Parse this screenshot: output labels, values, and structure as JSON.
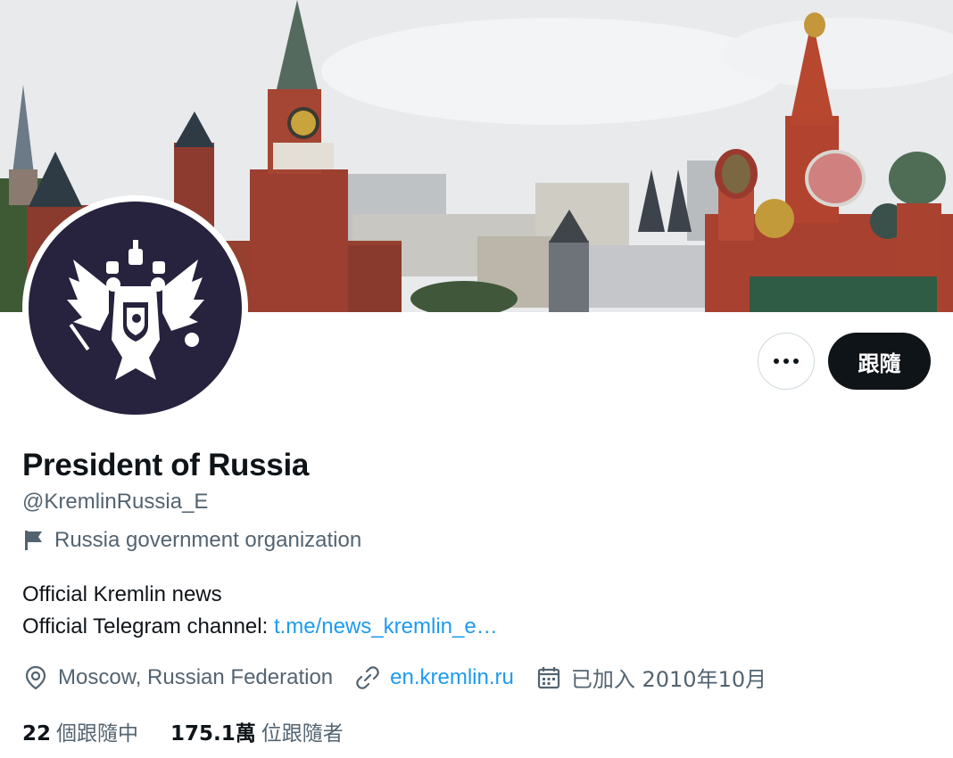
{
  "profile": {
    "name": "President of Russia",
    "handle": "@KremlinRussia_E",
    "affiliation": "Russia government organization",
    "bio_line1": "Official Kremlin news",
    "bio_line2_prefix": "Official Telegram channel: ",
    "bio_link": "t.me/news_kremlin_e…",
    "location": "Moscow, Russian Federation",
    "website": "en.kremlin.ru",
    "joined": "已加入 2010年10月",
    "following_count": "22",
    "following_label": "個跟隨中",
    "followers_count": "175.1萬",
    "followers_label": "位跟隨者"
  },
  "actions": {
    "follow_label": "跟隨",
    "more_icon": "more-horizontal-icon"
  },
  "icons": {
    "affiliation": "flag-icon",
    "location": "location-pin-icon",
    "website": "link-icon",
    "joined": "calendar-icon"
  },
  "colors": {
    "link": "#1d9bf0",
    "secondary_text": "#536471",
    "primary_text": "#0f1419",
    "avatar_bg": "#27223d",
    "follow_button_bg": "#0f1419"
  }
}
